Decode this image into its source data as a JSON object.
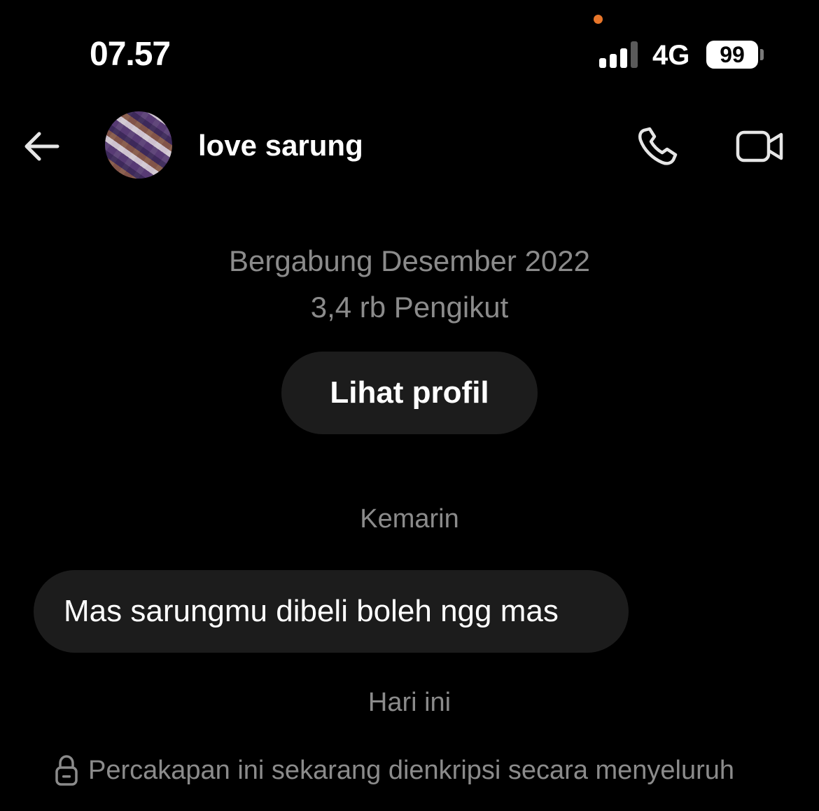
{
  "status_bar": {
    "time": "07.57",
    "network": "4G",
    "battery": "99",
    "signal_bars": 3,
    "signal_bars_total": 4,
    "privacy_dot_color": "#e8762a"
  },
  "header": {
    "contact_name": "love sarung",
    "icons": {
      "back": "arrow-left-icon",
      "call": "phone-icon",
      "video": "video-camera-icon"
    }
  },
  "profile": {
    "joined": "Bergabung Desember 2022",
    "followers": "3,4 rb Pengikut",
    "view_profile_label": "Lihat profil"
  },
  "conversation": {
    "groups": [
      {
        "date_label": "Kemarin",
        "messages": [
          {
            "text": "Mas sarungmu dibeli boleh ngg mas",
            "direction": "incoming"
          }
        ]
      },
      {
        "date_label": "Hari ini",
        "messages": []
      }
    ],
    "encryption_notice": "Percakapan ini sekarang dienkripsi secara menyeluruh",
    "encryption_icon": "lock-icon"
  },
  "colors": {
    "background": "#000000",
    "bubble": "#1c1c1c",
    "muted_text": "#8b8b8b",
    "text": "#ffffff"
  }
}
